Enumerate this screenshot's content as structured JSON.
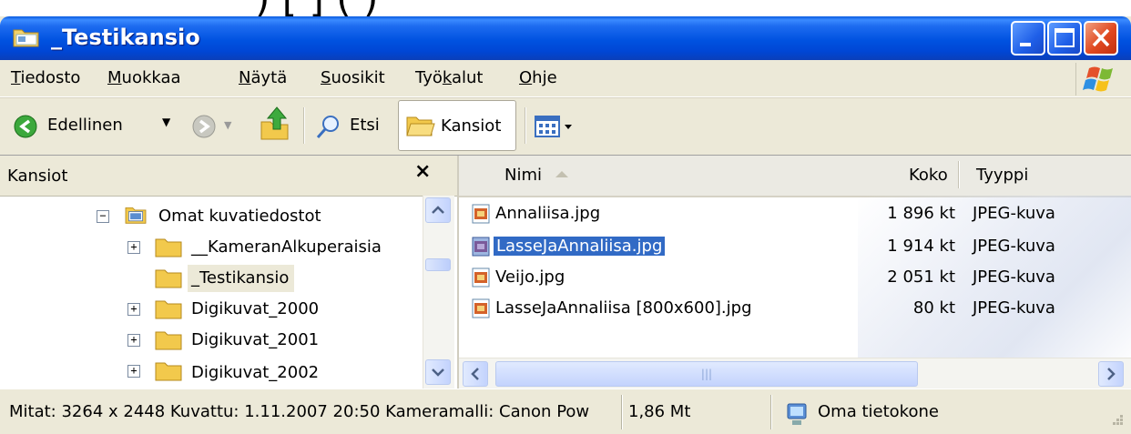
{
  "window": {
    "title": "_Testikansio"
  },
  "menu": {
    "items": [
      {
        "label": "Tiedosto",
        "accel": "T",
        "rest": "iedosto"
      },
      {
        "label": "Muokkaa",
        "accel": "M",
        "rest": "uokkaa"
      },
      {
        "label": "Näytä",
        "accel": "N",
        "rest": "äytä"
      },
      {
        "label": "Suosikit",
        "accel": "S",
        "rest": "uosikit"
      },
      {
        "label": "Työkalut",
        "pre": "Työ",
        "accel": "k",
        "rest": "alut"
      },
      {
        "label": "Ohje",
        "accel": "O",
        "rest": "hje"
      }
    ]
  },
  "toolbar": {
    "back_label": "Edellinen",
    "search_label": "Etsi",
    "folders_label": "Kansiot"
  },
  "folders": {
    "title": "Kansiot",
    "close_glyph": "×",
    "tree": [
      {
        "label": "Omat kuvatiedostot",
        "expander": "−"
      },
      {
        "label": "__KameranAlkuperaisia",
        "expander": "+"
      },
      {
        "label": "_Testikansio",
        "expander": ""
      },
      {
        "label": "Digikuvat_2000",
        "expander": "+"
      },
      {
        "label": "Digikuvat_2001",
        "expander": "+"
      },
      {
        "label": "Digikuvat_2002",
        "expander": "+"
      }
    ]
  },
  "files": {
    "columns": {
      "name": "Nimi",
      "size": "Koko",
      "type": "Tyyppi"
    },
    "rows": [
      {
        "name": "Annaliisa.jpg",
        "size": "1 896 kt",
        "type": "JPEG-kuva"
      },
      {
        "name": "LasseJaAnnaliisa.jpg",
        "size": "1 914 kt",
        "type": "JPEG-kuva"
      },
      {
        "name": "Veijo.jpg",
        "size": "2 051 kt",
        "type": "JPEG-kuva"
      },
      {
        "name": "LasseJaAnnaliisa [800x600].jpg",
        "size": "80 kt",
        "type": "JPEG-kuva"
      }
    ],
    "hscroll_grip": "|||"
  },
  "status": {
    "details": "Mitat: 3264 x 2448 Kuvattu: 1.11.2007 20:50 Kameramalli: Canon Pow",
    "size": "1,86 Mt",
    "location": "Oma tietokone"
  },
  "colors": {
    "selection": "#316AC5",
    "titlebar": "#0052E0",
    "close": "#E04820"
  }
}
